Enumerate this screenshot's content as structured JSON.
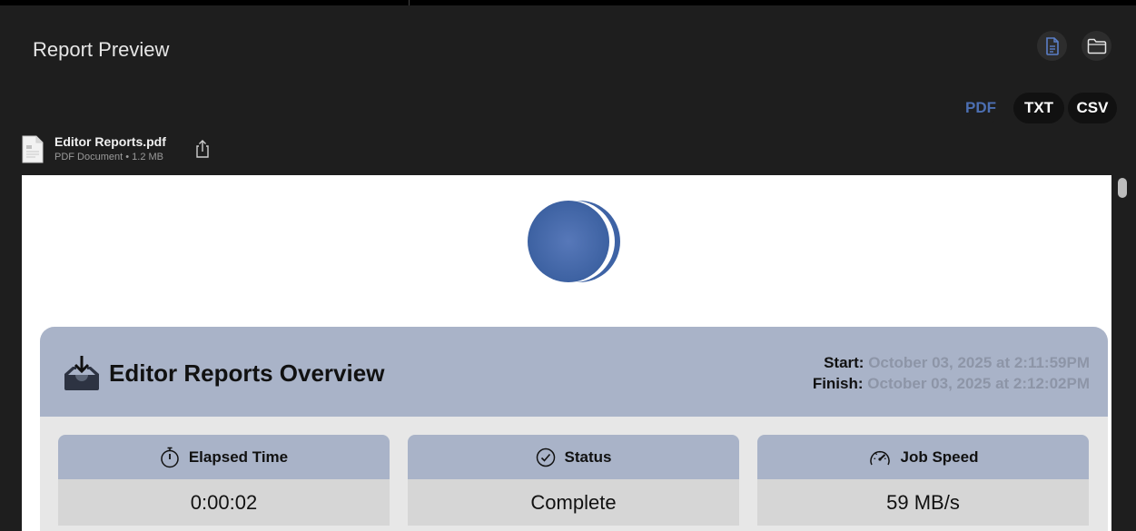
{
  "window": {
    "title": "Report Preview"
  },
  "toolbar": {
    "icons": [
      "document-icon",
      "folder-icon"
    ],
    "accent_color": "#4c6fb2",
    "formats": [
      {
        "label": "PDF",
        "selected": true
      },
      {
        "label": "TXT",
        "selected": false
      },
      {
        "label": "CSV",
        "selected": false
      }
    ]
  },
  "file": {
    "name": "Editor Reports.pdf",
    "meta": "PDF Document • 1.2 MB"
  },
  "report": {
    "logo_color": "#3e63a5",
    "overview_title": "Editor Reports Overview",
    "start_label": "Start:",
    "start_value": "October 03, 2025 at 2:11:59PM",
    "finish_label": "Finish:",
    "finish_value": "October 03, 2025 at 2:12:02PM",
    "stats": [
      {
        "label": "Elapsed Time",
        "value": "0:00:02",
        "icon": "stopwatch-icon"
      },
      {
        "label": "Status",
        "value": "Complete",
        "icon": "checkmark-circle-icon"
      },
      {
        "label": "Job Speed",
        "value": "59 MB/s",
        "icon": "speedometer-icon"
      }
    ]
  }
}
